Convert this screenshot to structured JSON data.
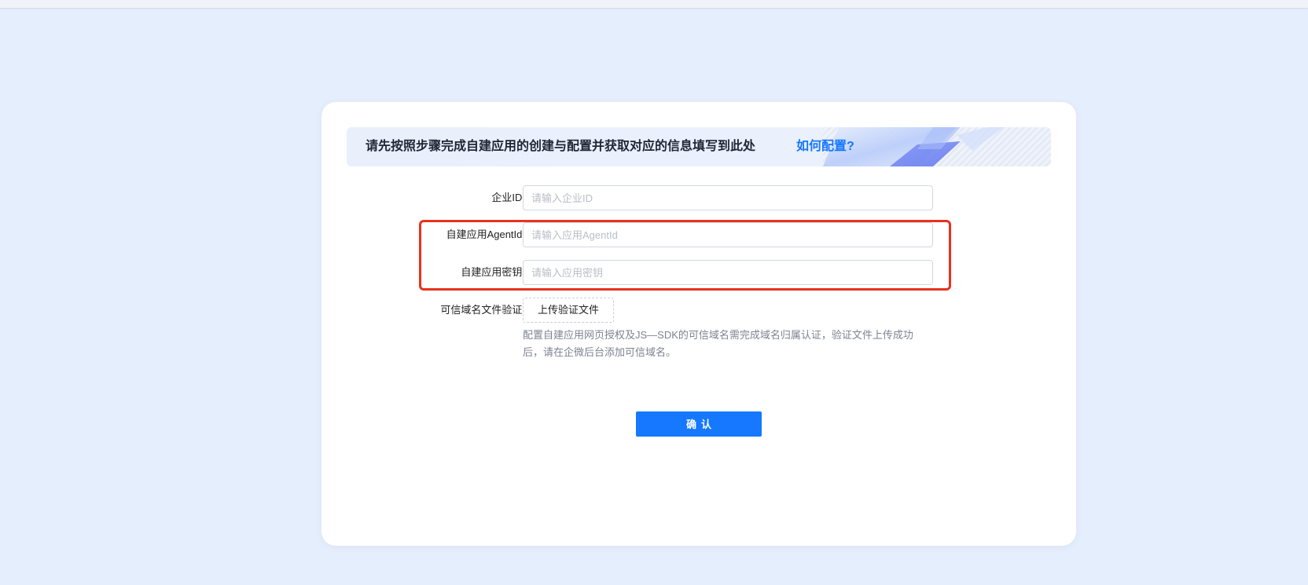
{
  "banner": {
    "text": "请先按照步骤完成自建应用的创建与配置并获取对应的信息填写到此处",
    "link": "如何配置?"
  },
  "form": {
    "corp_id": {
      "label": "企业ID:",
      "placeholder": "请输入企业ID",
      "value": ""
    },
    "agent_id": {
      "label": "自建应用AgentId:",
      "placeholder": "请输入应用AgentId",
      "value": ""
    },
    "secret": {
      "label": "自建应用密钥:",
      "placeholder": "请输入应用密钥",
      "value": ""
    },
    "domain_verify": {
      "label": "可信域名文件验证:",
      "button": "上传验证文件",
      "hint": "配置自建应用网页授权及JS—SDK的可信域名需完成域名归属认证，验证文件上传成功后，请在企微后台添加可信域名。"
    }
  },
  "confirm_label": "确认",
  "colors": {
    "page_bg": "#e5eefc",
    "primary": "#1677ff",
    "highlight_border": "#e8321f"
  }
}
